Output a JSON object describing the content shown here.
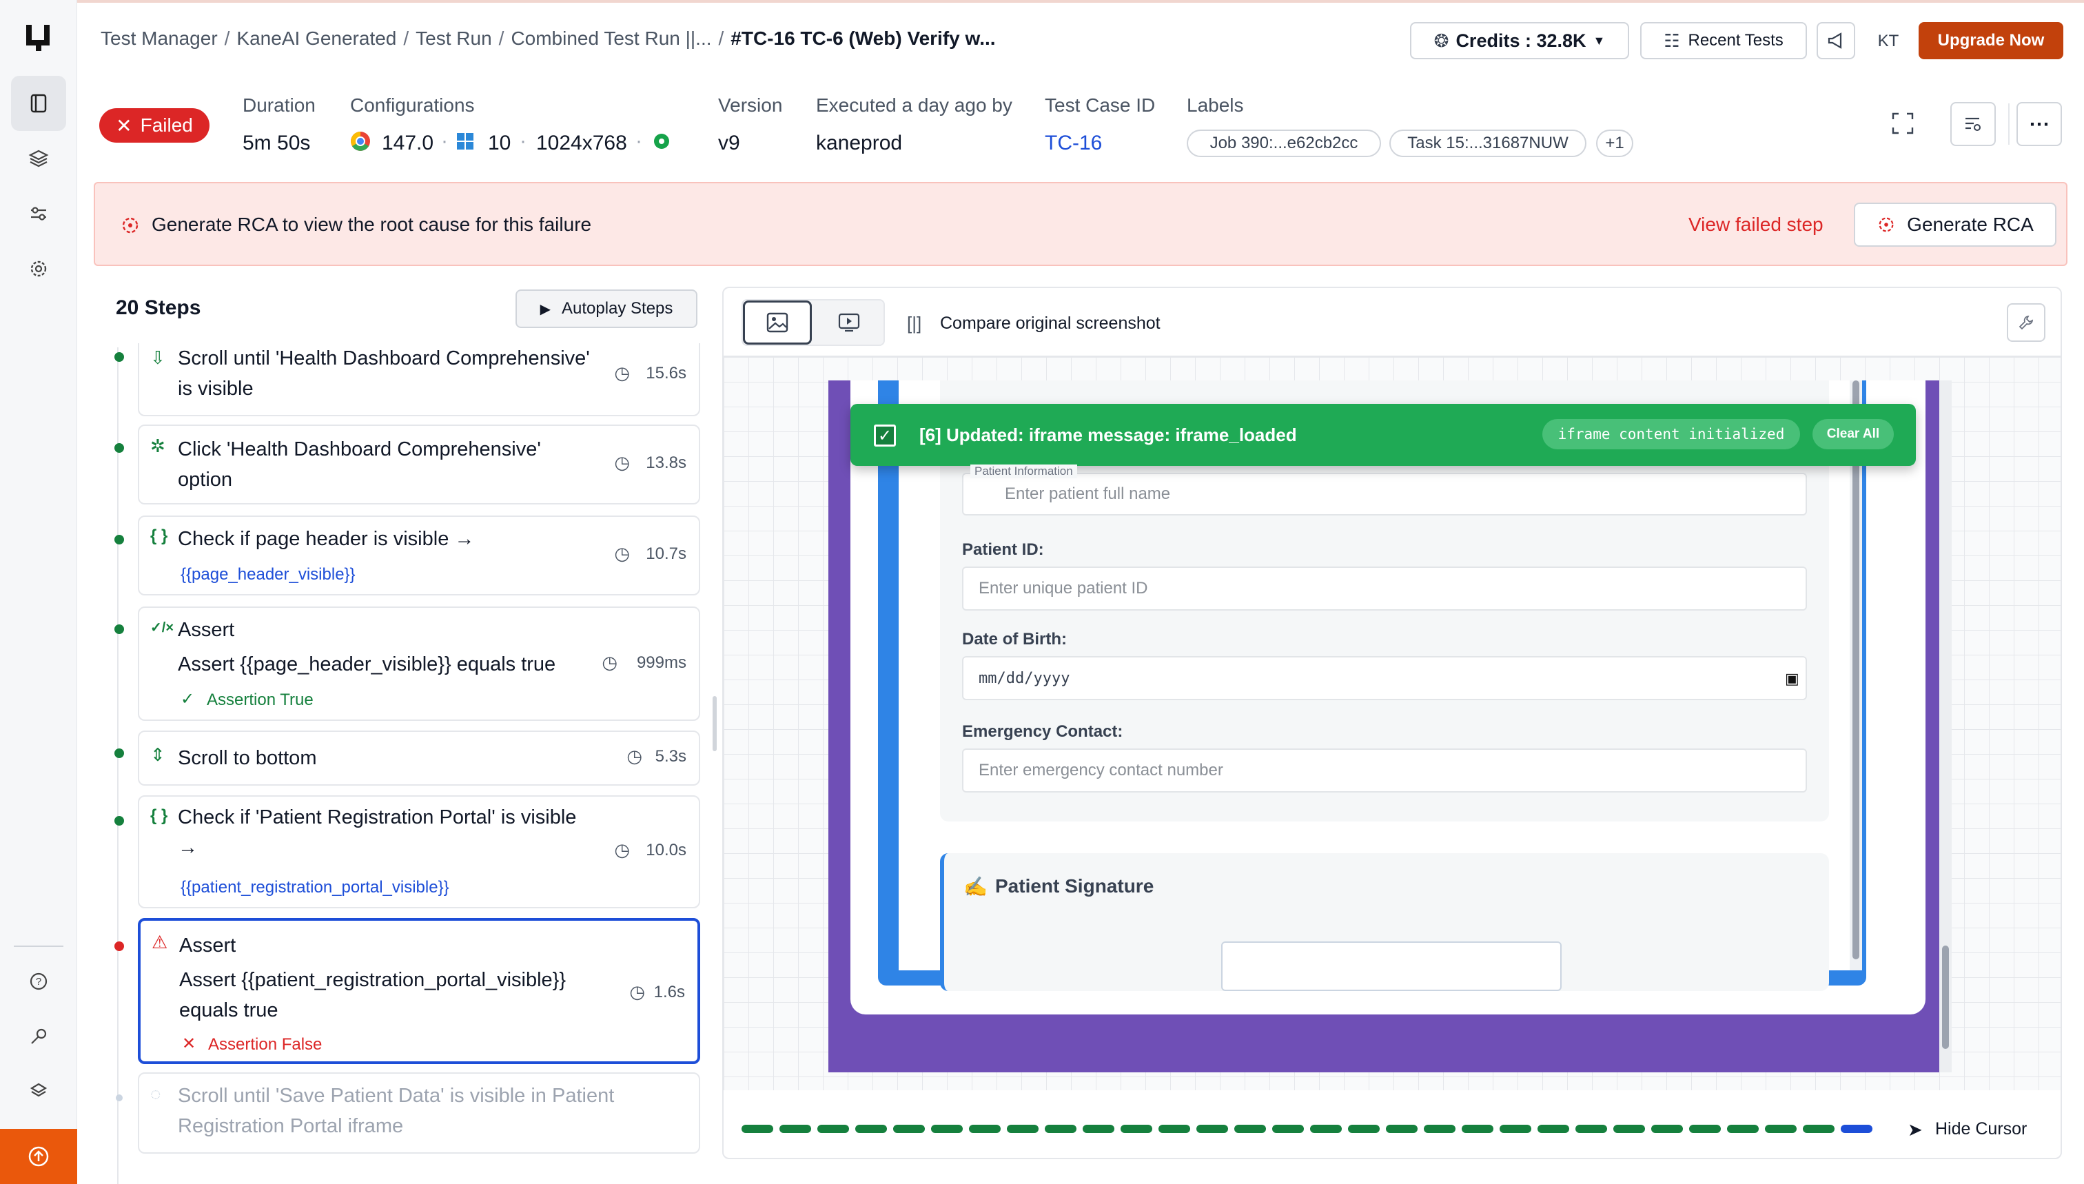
{
  "sidebar": {
    "logo": "logo-icon",
    "items": [
      "book-icon",
      "layers-icon",
      "sliders-icon",
      "gear-icon"
    ],
    "bottom": [
      "help-icon",
      "key-icon",
      "integrations-icon",
      "upload-icon"
    ]
  },
  "breadcrumb": [
    "Test Manager",
    "KaneAI Generated",
    "Test Run",
    "Combined Test Run ||...",
    "#TC-16 TC-6 (Web) Verify w..."
  ],
  "topbar": {
    "credits": "Credits : 32.8K",
    "recent": "Recent Tests",
    "avatar": "KT",
    "upgrade": "Upgrade Now"
  },
  "meta": {
    "status": "Failed",
    "duration_label": "Duration",
    "duration": "5m 50s",
    "config_label": "Configurations",
    "browser_version": "147.0",
    "os_version": "10",
    "resolution": "1024x768",
    "version_label": "Version",
    "version": "v9",
    "executed_label": "Executed a day ago by",
    "executed_by": "kaneprod",
    "testcase_label": "Test Case ID",
    "testcase": "TC-16",
    "labels_label": "Labels",
    "labels": [
      "Job 390:...e62cb2cc",
      "Task 15:...31687NUW",
      "+1"
    ]
  },
  "rca": {
    "message": "Generate RCA to view the root cause for this failure",
    "view_failed": "View failed step",
    "button": "Generate RCA"
  },
  "steps": {
    "count": "20 Steps",
    "autoplay": "Autoplay Steps",
    "items": [
      {
        "text": "Scroll until 'Health Dashboard Comprehensive' is visible",
        "time": "15.6s"
      },
      {
        "text": "Click 'Health Dashboard Comprehensive' option",
        "time": "13.8s"
      },
      {
        "text": "Check if page header is visible →",
        "var": "{{page_header_visible}}",
        "time": "10.7s"
      },
      {
        "title": "Assert",
        "text": "Assert {{page_header_visible}} equals true",
        "result": "Assertion True",
        "time": "999ms"
      },
      {
        "text": "Scroll to bottom",
        "time": "5.3s"
      },
      {
        "text": "Check if 'Patient Registration Portal' is visible →",
        "var": "{{patient_registration_portal_visible}}",
        "time": "10.0s"
      },
      {
        "title": "Assert",
        "text": "Assert {{patient_registration_portal_visible}} equals true",
        "result": "Assertion False",
        "time": "1.6s"
      },
      {
        "text": "Scroll until 'Save Patient Data' is visible in Patient Registration Portal iframe"
      }
    ]
  },
  "viewer": {
    "compare": "Compare original screenshot",
    "hide_cursor": "Hide Cursor",
    "toast": {
      "text": "[6] Updated: iframe message: iframe_loaded",
      "badge": "iframe content initialized",
      "clear": "Clear All"
    },
    "form": {
      "section_legend": "Patient Information",
      "name_placeholder": "Enter patient full name",
      "id_label": "Patient ID:",
      "id_placeholder": "Enter unique patient ID",
      "dob_label": "Date of Birth:",
      "dob_placeholder": "mm/dd/yyyy",
      "emergency_label": "Emergency Contact:",
      "emergency_placeholder": "Enter emergency contact number",
      "signature_title": "Patient Signature"
    },
    "progress": {
      "total_steps": 30,
      "completed_steps": 29
    }
  },
  "colors": {
    "accent": "#c2410c",
    "fail": "#dc2626",
    "success": "#15803d",
    "link": "#1d4ed8"
  }
}
